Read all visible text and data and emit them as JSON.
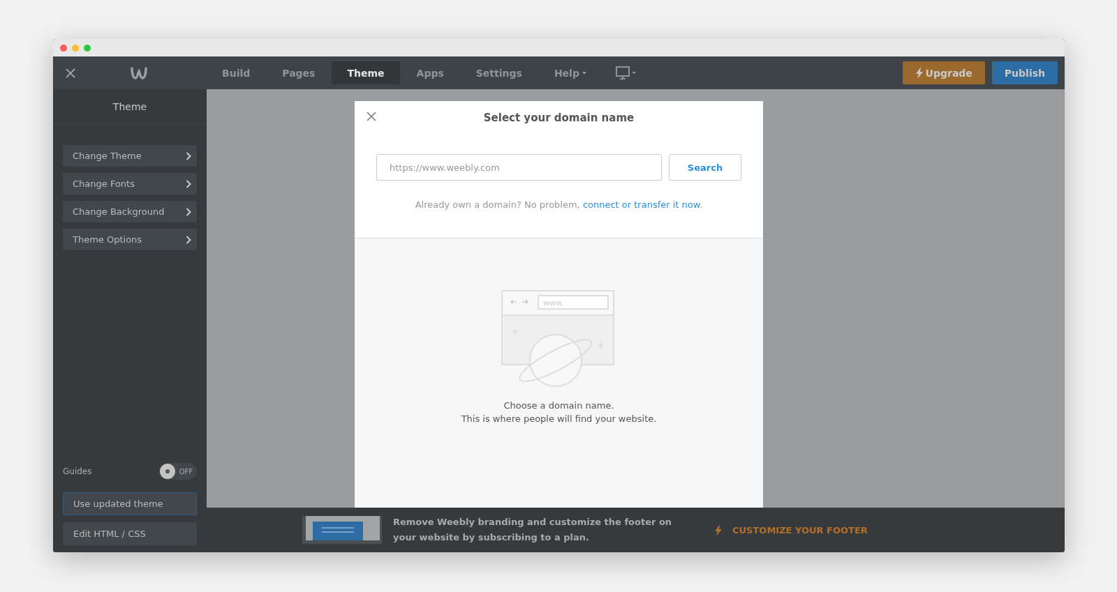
{
  "nav": {
    "tabs": [
      {
        "label": "Build",
        "selected": false
      },
      {
        "label": "Pages",
        "selected": false
      },
      {
        "label": "Theme",
        "selected": true
      },
      {
        "label": "Apps",
        "selected": false
      },
      {
        "label": "Settings",
        "selected": false
      },
      {
        "label": "Help",
        "selected": false,
        "dropdown": true
      }
    ],
    "actions": [
      {
        "label": "Upgrade",
        "kind": "upgrade"
      },
      {
        "label": "Publish",
        "kind": "publish"
      }
    ]
  },
  "sidebar": {
    "title": "Theme",
    "items": [
      {
        "label": "Change Theme"
      },
      {
        "label": "Change Fonts"
      },
      {
        "label": "Change Background"
      },
      {
        "label": "Theme Options"
      }
    ],
    "guides": {
      "label": "Guides",
      "on": false,
      "state_text": "OFF"
    },
    "bottom_buttons": [
      {
        "label": "Use updated theme",
        "highlighted": true
      },
      {
        "label": "Edit HTML / CSS",
        "highlighted": false
      }
    ]
  },
  "dialog": {
    "title": "Select your domain name",
    "search": {
      "placeholder": "https://www.weebly.com",
      "button": "Search"
    },
    "note": "Already own a domain? No problem,",
    "link": "connect or transfer it now",
    "note_end": ".",
    "illustration_text": "www.",
    "empty_lines": [
      "Choose a domain name.",
      "This is where people will find your website."
    ]
  },
  "footer_banner": {
    "message": "Remove Weebly branding and customize the footer on your website by subscribing to a plan.",
    "cta": "CUSTOMIZE YOUR FOOTER"
  }
}
